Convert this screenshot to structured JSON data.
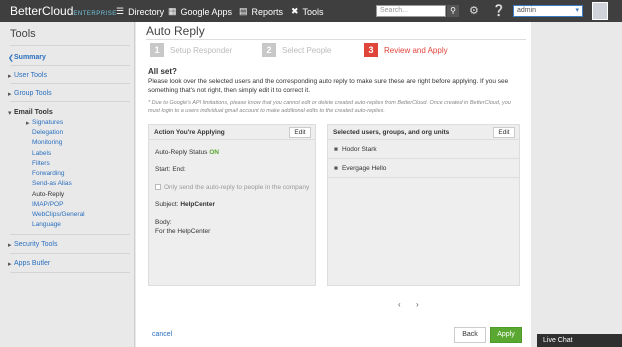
{
  "topbar": {
    "logo_main": "BetterCloud",
    "logo_sub": "ENTERPRISE",
    "nav": [
      {
        "label": "Directory",
        "icon": "directory-icon"
      },
      {
        "label": "Google Apps",
        "icon": "google-apps-icon"
      },
      {
        "label": "Reports",
        "icon": "reports-icon"
      },
      {
        "label": "Tools",
        "icon": "tools-icon"
      }
    ],
    "search_placeholder": "Search...",
    "user": "admin"
  },
  "sidebar": {
    "title": "Tools",
    "sections": [
      {
        "label": "Summary"
      },
      {
        "label": "User Tools"
      },
      {
        "label": "Group Tools"
      },
      {
        "label": "Email Tools"
      },
      {
        "label": "Security Tools"
      },
      {
        "label": "Apps Butler"
      }
    ],
    "email_items": [
      "Signatures",
      "Delegation",
      "Monitoring",
      "Labels",
      "Filters",
      "Forwarding",
      "Send-as Alias",
      "Auto-Reply",
      "IMAP/POP",
      "WebClips/General",
      "Language"
    ]
  },
  "main": {
    "title": "Auto Reply",
    "steps": [
      {
        "num": "1",
        "label": "Setup Responder"
      },
      {
        "num": "2",
        "label": "Select People"
      },
      {
        "num": "3",
        "label": "Review and Apply"
      }
    ],
    "heading": "All set?",
    "description": "Please look over the selected users and the corresponding auto reply to make sure these are right before applying. If you see something that's not right, then simply edit it to correct it.",
    "note": "* Due to Google's API limitations, please know that you cannot edit or delete created auto-replies from BetterCloud. Once created in BetterCloud, you must login to a users individual gmail account to make additional edits to the created auto-replies.",
    "left_panel": {
      "title": "Action You're Applying",
      "edit": "Edit",
      "status_label": "Auto-Reply Status",
      "status_value": "ON",
      "start_end": "Start: End:",
      "checkbox_label": "Only send the auto-reply to people in the company",
      "subject_label": "Subject:",
      "subject_value": "HelpCenter",
      "body_label": "Body:",
      "body_value": "For the HelpCenter"
    },
    "right_panel": {
      "title": "Selected users, groups, and org units",
      "edit": "Edit",
      "people": [
        "Hodor Stark",
        "Evergage Hello"
      ]
    },
    "pager_prev": "‹",
    "pager_next": "›",
    "cancel": "cancel",
    "back": "Back",
    "apply": "Apply"
  },
  "livechat": "Live Chat"
}
